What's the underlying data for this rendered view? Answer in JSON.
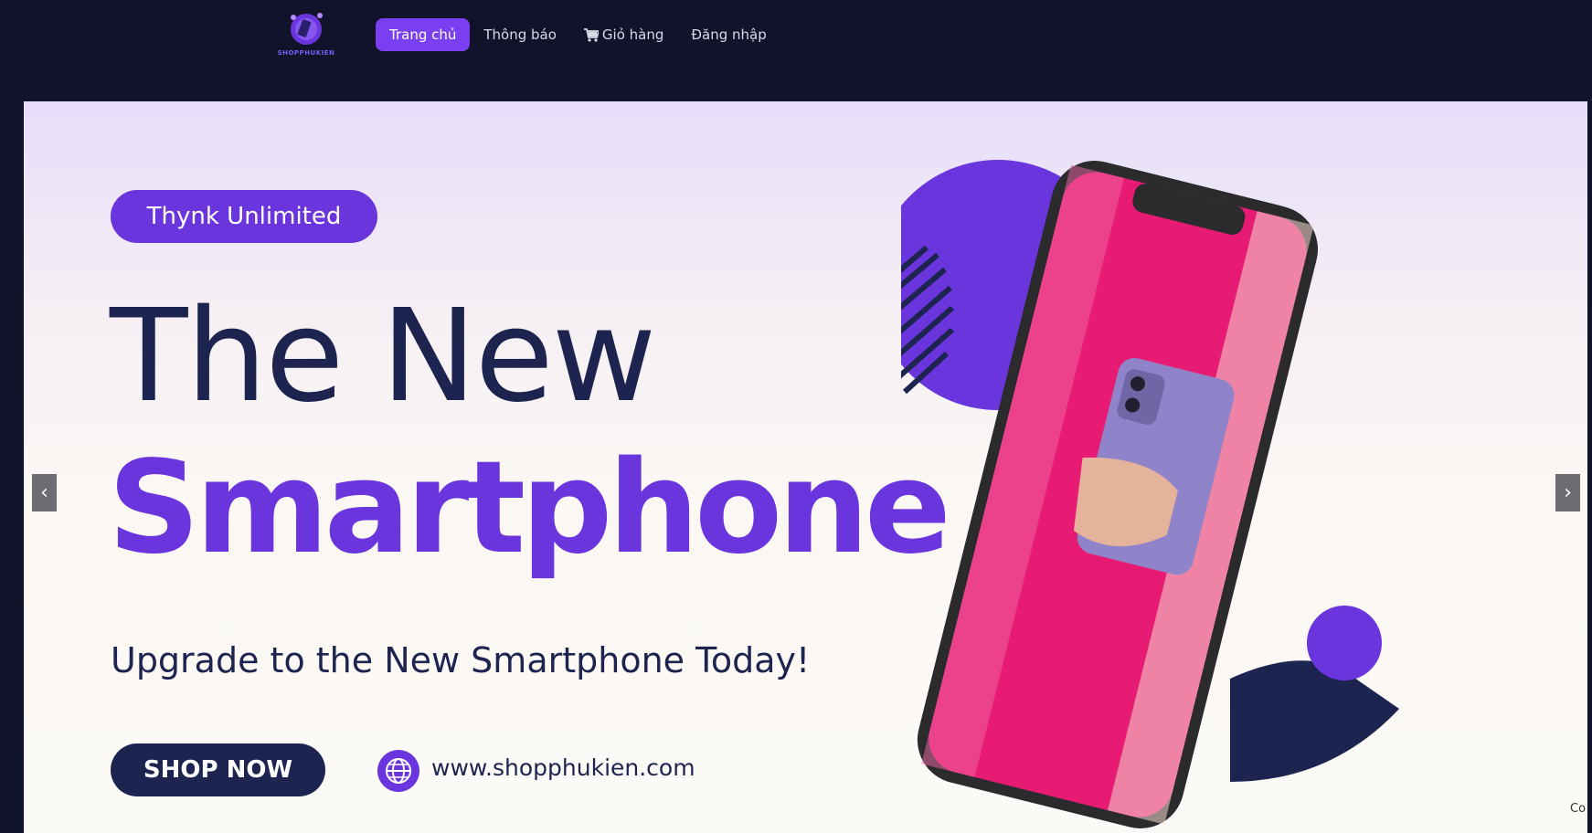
{
  "header": {
    "logo_text": "SHOPPHUKIEN",
    "nav": [
      {
        "label": "Trang chủ",
        "active": true
      },
      {
        "label": "Thông báo",
        "active": false
      },
      {
        "label": "Giỏ hàng",
        "active": false,
        "icon": "cart-icon"
      },
      {
        "label": "Đăng nhập",
        "active": false
      }
    ]
  },
  "hero": {
    "badge": "Thynk Unlimited",
    "title_line1": "The New",
    "title_line2": "Smartphone",
    "subtitle": "Upgrade to the New Smartphone Today!",
    "cta": "SHOP NOW",
    "website": "www.shopphukien.com"
  },
  "carousel": {
    "prev_label": "‹",
    "next_label": "›"
  },
  "corner_text": "Co",
  "colors": {
    "background": "#11132b",
    "accent": "#6b35dd",
    "navy": "#1d2450",
    "nav_active": "#7a3ff0",
    "phone_screen": "#e81b74"
  }
}
